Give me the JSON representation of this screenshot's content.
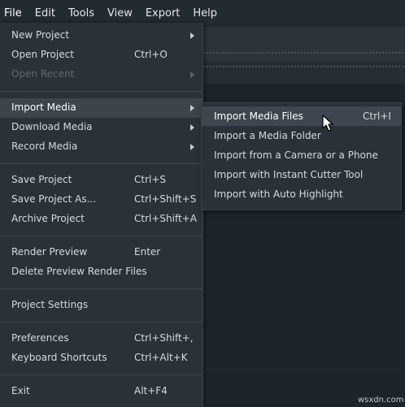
{
  "menubar": {
    "items": [
      "File",
      "Edit",
      "Tools",
      "View",
      "Export",
      "Help"
    ]
  },
  "file_menu": {
    "new_project": {
      "label": "New Project"
    },
    "open_project": {
      "label": "Open Project",
      "shortcut": "Ctrl+O"
    },
    "open_recent": {
      "label": "Open Recent"
    },
    "import_media": {
      "label": "Import Media"
    },
    "download_media": {
      "label": "Download Media"
    },
    "record_media": {
      "label": "Record Media"
    },
    "save_project": {
      "label": "Save Project",
      "shortcut": "Ctrl+S"
    },
    "save_project_as": {
      "label": "Save Project As...",
      "shortcut": "Ctrl+Shift+S"
    },
    "archive_project": {
      "label": "Archive Project",
      "shortcut": "Ctrl+Shift+A"
    },
    "render_preview": {
      "label": "Render Preview",
      "shortcut": "Enter"
    },
    "delete_preview_render_files": {
      "label": "Delete Preview Render Files"
    },
    "project_settings": {
      "label": "Project Settings"
    },
    "preferences": {
      "label": "Preferences",
      "shortcut": "Ctrl+Shift+,"
    },
    "keyboard_shortcuts": {
      "label": "Keyboard Shortcuts",
      "shortcut": "Ctrl+Alt+K"
    },
    "exit": {
      "label": "Exit",
      "shortcut": "Alt+F4"
    }
  },
  "import_submenu": {
    "items": [
      {
        "label": "Import Media Files",
        "shortcut": "Ctrl+I"
      },
      {
        "label": "Import a Media Folder"
      },
      {
        "label": "Import from a Camera or a Phone"
      },
      {
        "label": "Import with Instant Cutter Tool"
      },
      {
        "label": "Import with Auto Highlight"
      }
    ]
  },
  "watermark": "wsxdn.com"
}
